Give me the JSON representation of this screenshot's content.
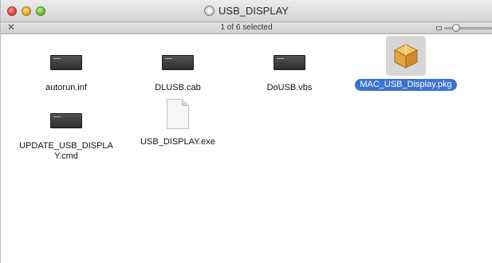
{
  "window": {
    "title": "USB_DISPLAY",
    "status": "1 of 6 selected",
    "selection_color": "#3a73d2",
    "icon_size_slider_level": 0.2
  },
  "items": [
    {
      "label": "autorun.inf",
      "icon": "terminal-icon",
      "selected": false
    },
    {
      "label": "DLUSB.cab",
      "icon": "terminal-icon",
      "selected": false
    },
    {
      "label": "DoUSB.vbs",
      "icon": "terminal-icon",
      "selected": false
    },
    {
      "label": "MAC_USB_Display.pkg",
      "icon": "package-icon",
      "selected": true
    },
    {
      "label": "UPDATE_USB_DISPLAY.cmd",
      "icon": "terminal-icon",
      "selected": false
    },
    {
      "label": "USB_DISPLAY.exe",
      "icon": "document-icon",
      "selected": false
    }
  ]
}
